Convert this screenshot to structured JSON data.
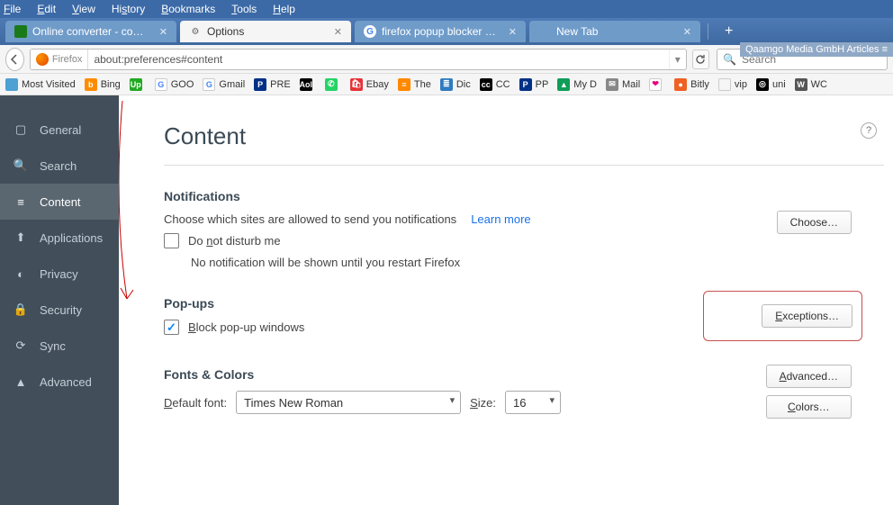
{
  "menubar": [
    "File",
    "Edit",
    "View",
    "History",
    "Bookmarks",
    "Tools",
    "Help"
  ],
  "tabs": [
    {
      "label": "Online converter - convert …",
      "active": false,
      "icon_bg": "#1a7a1a",
      "icon_text": ""
    },
    {
      "label": "Options",
      "active": true,
      "icon": "gear"
    },
    {
      "label": "firefox popup blocker - Goo…",
      "active": false,
      "icon": "google"
    },
    {
      "label": "New Tab",
      "active": false,
      "icon": ""
    }
  ],
  "nav": {
    "identity_label": "Firefox",
    "url": "about:preferences#content",
    "search_placeholder": "Search"
  },
  "badge_text": "Qaamgo Media GmbH Articles ≡",
  "bookmarks": [
    {
      "label": "Most Visited",
      "bg": "#4ea1d3",
      "text": ""
    },
    {
      "label": "Bing",
      "bg": "#ff8c00",
      "text": "b"
    },
    {
      "label": "",
      "bg": "#22aa22",
      "text": "Up"
    },
    {
      "label": "GOO",
      "bg": "#fff",
      "text": "G",
      "fg": "#4285F4"
    },
    {
      "label": "Gmail",
      "bg": "#fff",
      "text": "G",
      "fg": "#4285F4"
    },
    {
      "label": "PRE",
      "bg": "#003087",
      "text": "P"
    },
    {
      "label": "",
      "bg": "#000",
      "text": "Aol"
    },
    {
      "label": "",
      "bg": "#25d366",
      "text": "✆"
    },
    {
      "label": "Ebay",
      "bg": "#e53238",
      "text": "🛍"
    },
    {
      "label": "The",
      "bg": "#ff8800",
      "text": "≡"
    },
    {
      "label": "Dic",
      "bg": "#2e7cc0",
      "text": "≣"
    },
    {
      "label": "CC",
      "bg": "#000",
      "text": "cc"
    },
    {
      "label": "PP",
      "bg": "#003087",
      "text": "P"
    },
    {
      "label": "My D",
      "bg": "#0f9d58",
      "text": "▲"
    },
    {
      "label": "Mail",
      "bg": "#888",
      "text": "✉"
    },
    {
      "label": "",
      "bg": "#fff",
      "text": "❤",
      "fg": "#e6007e"
    },
    {
      "label": "Bitly",
      "bg": "#ee6123",
      "text": "●"
    },
    {
      "label": "vip",
      "bg": "transparent",
      "text": ""
    },
    {
      "label": "uni",
      "bg": "#000",
      "text": "◎"
    },
    {
      "label": "WC",
      "bg": "#555",
      "text": "W"
    }
  ],
  "sidebar": [
    {
      "label": "General",
      "icon": "▢"
    },
    {
      "label": "Search",
      "icon": "🔍"
    },
    {
      "label": "Content",
      "icon": "≡",
      "active": true
    },
    {
      "label": "Applications",
      "icon": "⬆"
    },
    {
      "label": "Privacy",
      "icon": "◐"
    },
    {
      "label": "Security",
      "icon": "🔒"
    },
    {
      "label": "Sync",
      "icon": "⟳"
    },
    {
      "label": "Advanced",
      "icon": "▲"
    }
  ],
  "page": {
    "title": "Content",
    "notifications": {
      "heading": "Notifications",
      "desc": "Choose which sites are allowed to send you notifications",
      "learn": "Learn more",
      "choose": "Choose…",
      "dnd": "Do not disturb me",
      "dnd_sub": "No notification will be shown until you restart Firefox"
    },
    "popups": {
      "heading": "Pop-ups",
      "block": "Block pop-up windows",
      "exceptions": "Exceptions…"
    },
    "fonts": {
      "heading": "Fonts & Colors",
      "default_label": "Default font:",
      "default_value": "Times New Roman",
      "size_label": "Size:",
      "size_value": "16",
      "advanced": "Advanced…",
      "colors": "Colors…"
    }
  }
}
